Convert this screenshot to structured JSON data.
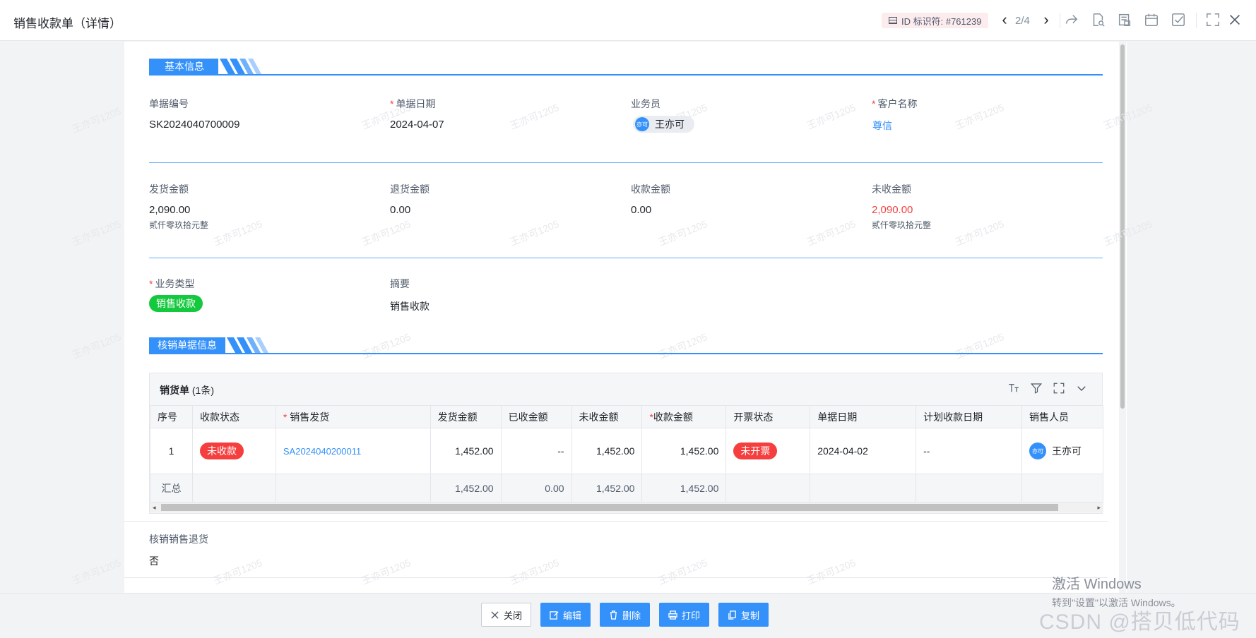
{
  "window": {
    "title": "销售收款单（详情）",
    "id_chip": "ID 标识符: #761239",
    "pager": "2/4"
  },
  "watermark": "王亦可1205",
  "basic_section": {
    "title": "基本信息",
    "fields": {
      "doc_no": {
        "label": "单据编号",
        "value": "SK2024040700009"
      },
      "doc_date": {
        "label": "单据日期",
        "value": "2024-04-07"
      },
      "salesman": {
        "label": "业务员",
        "value": "王亦可",
        "avatar": "亦可"
      },
      "customer": {
        "label": "客户名称",
        "value": "尊信"
      },
      "ship_amount": {
        "label": "发货金额",
        "value": "2,090.00",
        "words": "贰仟零玖拾元整"
      },
      "return_amount": {
        "label": "退货金额",
        "value": "0.00"
      },
      "collected_amount": {
        "label": "收款金额",
        "value": "0.00"
      },
      "uncollected_amount": {
        "label": "未收金额",
        "value": "2,090.00",
        "words": "贰仟零玖拾元整"
      },
      "biz_type": {
        "label": "业务类型",
        "value": "销售收款"
      },
      "summary": {
        "label": "摘要",
        "value": "销售收款"
      }
    }
  },
  "writeoff_section": {
    "title": "核销单据信息",
    "table_title": "销货单",
    "table_count": "(1条)",
    "columns": [
      "序号",
      "收款状态",
      "销售发货",
      "发货金额",
      "已收金额",
      "未收金额",
      "收款金额",
      "开票状态",
      "单据日期",
      "计划收款日期",
      "销售人员"
    ],
    "row": {
      "index": "1",
      "collect_status": "未收款",
      "shipment": "SA2024040200011",
      "ship_amount": "1,452.00",
      "received": "--",
      "unreceived": "1,452.00",
      "collect_amount": "1,452.00",
      "invoice_status": "未开票",
      "doc_date": "2024-04-02",
      "plan_date": "--",
      "sales_person": "王亦可",
      "sales_avatar": "亦可"
    },
    "summary_row": {
      "label": "汇总",
      "ship_amount": "1,452.00",
      "received": "0.00",
      "unreceived": "1,452.00",
      "collect_amount": "1,452.00"
    },
    "return_writeoff": {
      "label": "核销销售退货",
      "value": "否"
    }
  },
  "footer": {
    "close": "关闭",
    "edit": "编辑",
    "delete": "删除",
    "print": "打印",
    "copy": "复制"
  },
  "overlay": {
    "windows_line1": "激活 Windows",
    "windows_line2": "转到\"设置\"以激活 Windows。",
    "csdn": "CSDN @搭贝低代码"
  },
  "colors": {
    "accent": "#3491fa",
    "danger": "#f53f3f",
    "success": "#14c93e"
  }
}
